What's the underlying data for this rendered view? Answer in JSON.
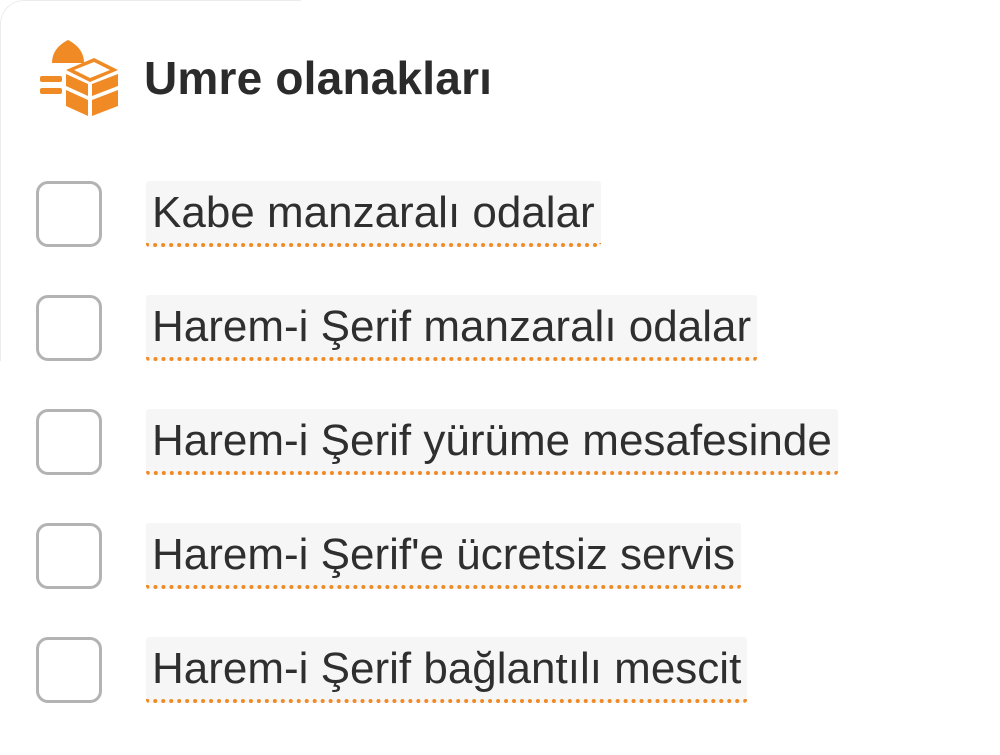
{
  "header": {
    "icon": "kaaba-icon",
    "title": "Umre olanakları"
  },
  "colors": {
    "accent": "#f08a24",
    "checkbox_border": "#b3b3b3",
    "label_bg": "#f6f6f6",
    "text": "#2f2f2f"
  },
  "options": [
    {
      "label": "Kabe manzaralı odalar",
      "checked": false
    },
    {
      "label": "Harem-i Şerif manzaralı odalar",
      "checked": false
    },
    {
      "label": "Harem-i Şerif yürüme mesafesinde",
      "checked": false
    },
    {
      "label": "Harem-i Şerif'e ücretsiz servis",
      "checked": false
    },
    {
      "label": "Harem-i Şerif bağlantılı mescit",
      "checked": false
    }
  ]
}
